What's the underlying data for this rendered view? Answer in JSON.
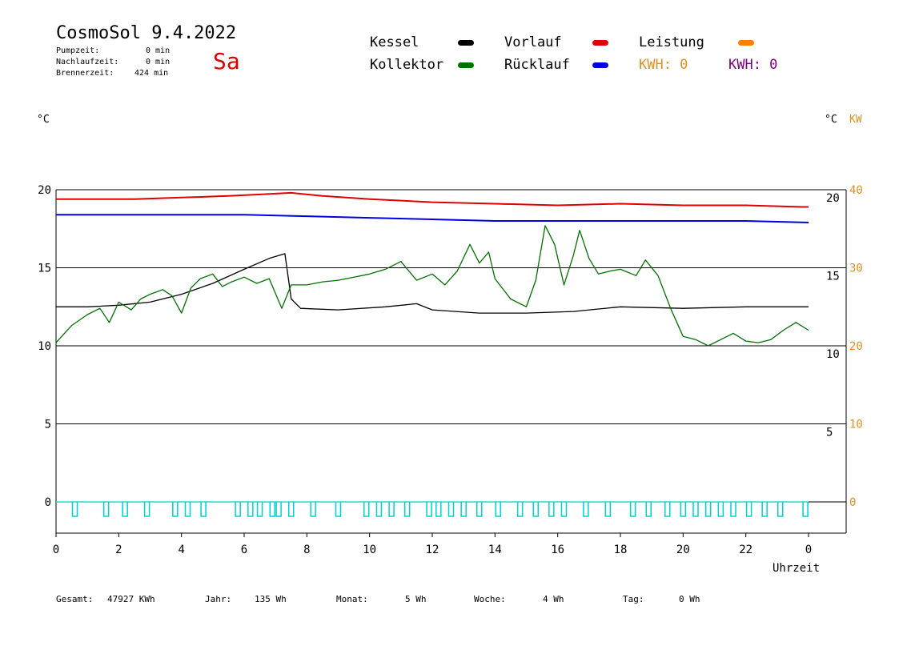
{
  "header": {
    "title": "CosmoSol 9.4.2022",
    "day": "Sa",
    "pumpzeit_label": "Pumpzeit:",
    "pumpzeit_value": "0 min",
    "nachlauf_label": "Nachlaufzeit:",
    "nachlauf_value": "0 min",
    "brenner_label": "Brennerzeit:",
    "brenner_value": "424 min"
  },
  "legend": {
    "kessel": "Kessel",
    "kollektor": "Kollektor",
    "vorlauf": "Vorlauf",
    "ruecklauf": "Rücklauf",
    "leistung": "Leistung",
    "kwh1": "KWH: 0",
    "kwh2": "KWH: 0"
  },
  "footer": {
    "gesamt_label": "Gesamt:",
    "gesamt_value": "47927 KWh",
    "jahr_label": "Jahr:",
    "jahr_value": "135 Wh",
    "monat_label": "Monat:",
    "monat_value": "5 Wh",
    "woche_label": "Woche:",
    "woche_value": "4 Wh",
    "tag_label": "Tag:",
    "tag_value": "0 Wh"
  },
  "colors": {
    "kessel": "#000000",
    "kollektor": "#007000",
    "vorlauf": "#e00000",
    "ruecklauf": "#0000e0",
    "leistung": "#ff8000",
    "kwh2": "#800080",
    "pump": "#00d0d0",
    "orange_axis": "#e09020"
  },
  "chart_data": {
    "type": "line",
    "xlabel": "Uhrzeit",
    "y_left_unit": "°C",
    "y_right_unit": "°C",
    "y_right2_unit": "KW",
    "xlim": [
      0,
      24
    ],
    "ylim_left": [
      -2,
      21
    ],
    "x_ticks": [
      0,
      2,
      4,
      6,
      8,
      10,
      12,
      14,
      16,
      18,
      20,
      22,
      24
    ],
    "x_tick_labels": [
      "0",
      "2",
      "4",
      "6",
      "8",
      "10",
      "12",
      "14",
      "16",
      "18",
      "20",
      "22",
      "0"
    ],
    "y_left_ticks": [
      0,
      5,
      10,
      15,
      20
    ],
    "y_right_ticks": [
      5,
      10,
      15,
      20
    ],
    "y_right_tick_values": [
      4.5,
      9.5,
      14.5,
      19.5
    ],
    "y_right2_ticks": [
      0,
      10,
      20,
      30,
      40
    ],
    "series": [
      {
        "name": "Vorlauf",
        "color_key": "vorlauf",
        "points": [
          [
            0,
            19.4
          ],
          [
            1,
            19.4
          ],
          [
            2.5,
            19.4
          ],
          [
            4,
            19.5
          ],
          [
            5.5,
            19.6
          ],
          [
            6.5,
            19.7
          ],
          [
            7.5,
            19.8
          ],
          [
            8.5,
            19.6
          ],
          [
            10,
            19.4
          ],
          [
            12,
            19.2
          ],
          [
            14,
            19.1
          ],
          [
            16,
            19.0
          ],
          [
            18,
            19.1
          ],
          [
            20,
            19.0
          ],
          [
            22,
            19.0
          ],
          [
            23.8,
            18.9
          ],
          [
            24,
            18.9
          ]
        ]
      },
      {
        "name": "Rücklauf",
        "color_key": "ruecklauf",
        "points": [
          [
            0,
            18.4
          ],
          [
            3,
            18.4
          ],
          [
            6,
            18.4
          ],
          [
            8,
            18.3
          ],
          [
            10,
            18.2
          ],
          [
            12,
            18.1
          ],
          [
            14,
            18.0
          ],
          [
            16,
            18.0
          ],
          [
            18,
            18.0
          ],
          [
            20,
            18.0
          ],
          [
            22,
            18.0
          ],
          [
            24,
            17.9
          ]
        ]
      },
      {
        "name": "Kessel",
        "color_key": "kessel",
        "points": [
          [
            0,
            12.5
          ],
          [
            1,
            12.5
          ],
          [
            2,
            12.6
          ],
          [
            3,
            12.8
          ],
          [
            4,
            13.3
          ],
          [
            5,
            14.0
          ],
          [
            6,
            14.9
          ],
          [
            6.8,
            15.6
          ],
          [
            7.3,
            15.9
          ],
          [
            7.5,
            13.0
          ],
          [
            7.8,
            12.4
          ],
          [
            9,
            12.3
          ],
          [
            10.5,
            12.5
          ],
          [
            11.5,
            12.7
          ],
          [
            12,
            12.3
          ],
          [
            13.5,
            12.1
          ],
          [
            15,
            12.1
          ],
          [
            16.5,
            12.2
          ],
          [
            18,
            12.5
          ],
          [
            20,
            12.4
          ],
          [
            22,
            12.5
          ],
          [
            24,
            12.5
          ]
        ]
      },
      {
        "name": "Kollektor",
        "color_key": "kollektor",
        "points": [
          [
            0,
            10.2
          ],
          [
            0.5,
            11.3
          ],
          [
            1,
            12.0
          ],
          [
            1.4,
            12.4
          ],
          [
            1.7,
            11.5
          ],
          [
            2,
            12.8
          ],
          [
            2.4,
            12.3
          ],
          [
            2.7,
            13.0
          ],
          [
            3,
            13.3
          ],
          [
            3.4,
            13.6
          ],
          [
            3.7,
            13.2
          ],
          [
            4,
            12.1
          ],
          [
            4.3,
            13.7
          ],
          [
            4.6,
            14.3
          ],
          [
            5,
            14.6
          ],
          [
            5.3,
            13.8
          ],
          [
            5.6,
            14.1
          ],
          [
            6,
            14.4
          ],
          [
            6.4,
            14.0
          ],
          [
            6.8,
            14.3
          ],
          [
            7.2,
            12.4
          ],
          [
            7.5,
            13.9
          ],
          [
            8,
            13.9
          ],
          [
            8.5,
            14.1
          ],
          [
            9,
            14.2
          ],
          [
            9.5,
            14.4
          ],
          [
            10,
            14.6
          ],
          [
            10.5,
            14.9
          ],
          [
            11,
            15.4
          ],
          [
            11.5,
            14.2
          ],
          [
            12,
            14.6
          ],
          [
            12.4,
            13.9
          ],
          [
            12.8,
            14.8
          ],
          [
            13.2,
            16.5
          ],
          [
            13.5,
            15.3
          ],
          [
            13.8,
            16.0
          ],
          [
            14,
            14.3
          ],
          [
            14.5,
            13.0
          ],
          [
            15,
            12.5
          ],
          [
            15.3,
            14.2
          ],
          [
            15.6,
            17.7
          ],
          [
            15.9,
            16.5
          ],
          [
            16.2,
            13.9
          ],
          [
            16.5,
            15.8
          ],
          [
            16.7,
            17.4
          ],
          [
            17,
            15.6
          ],
          [
            17.3,
            14.6
          ],
          [
            17.7,
            14.8
          ],
          [
            18,
            14.9
          ],
          [
            18.5,
            14.5
          ],
          [
            18.8,
            15.5
          ],
          [
            19.2,
            14.5
          ],
          [
            19.6,
            12.4
          ],
          [
            20,
            10.6
          ],
          [
            20.4,
            10.4
          ],
          [
            20.8,
            10.0
          ],
          [
            21.2,
            10.4
          ],
          [
            21.6,
            10.8
          ],
          [
            22,
            10.3
          ],
          [
            22.4,
            10.2
          ],
          [
            22.8,
            10.4
          ],
          [
            23.2,
            11.0
          ],
          [
            23.6,
            11.5
          ],
          [
            24,
            11.0
          ]
        ]
      },
      {
        "name": "Pumpe",
        "color_key": "pump",
        "points": [
          [
            0,
            0
          ],
          [
            24,
            0
          ]
        ]
      }
    ],
    "pump_pulses": [
      0.6,
      1.6,
      2.2,
      2.9,
      3.8,
      4.2,
      4.7,
      5.8,
      6.2,
      6.5,
      6.9,
      7.1,
      7.5,
      8.2,
      9.0,
      9.9,
      10.3,
      10.7,
      11.2,
      11.9,
      12.2,
      12.6,
      13.0,
      13.5,
      14.1,
      14.8,
      15.3,
      15.8,
      16.2,
      16.9,
      17.6,
      18.4,
      18.9,
      19.5,
      20.0,
      20.4,
      20.8,
      21.2,
      21.6,
      22.1,
      22.6,
      23.1,
      23.9
    ],
    "grid": true,
    "legend_position": "top"
  }
}
